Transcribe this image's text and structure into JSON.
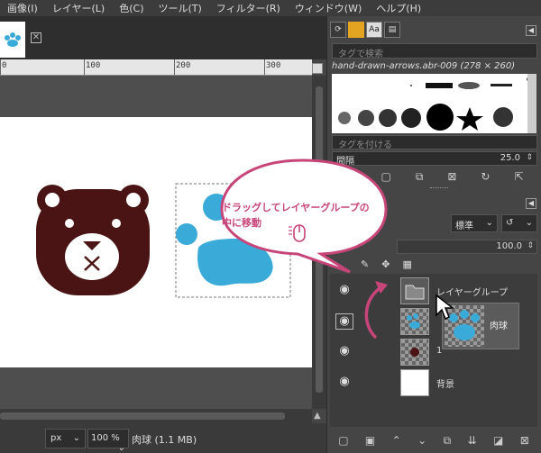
{
  "menu": [
    "画像(I)",
    "レイヤー(L)",
    "色(C)",
    "ツール(T)",
    "フィルター(R)",
    "ウィンドウ(W)",
    "ヘルプ(H)"
  ],
  "ruler": [
    "0",
    "100",
    "200",
    "300"
  ],
  "status": {
    "unit": "px",
    "zoom": "100 %",
    "text": "肉球 (1.1 MB)"
  },
  "brushes": {
    "tab_text": "Aa",
    "tag_search_placeholder": "タグで検索",
    "title": "hand-drawn-arrows.abr-009 (278 × 260)",
    "tag_attach_placeholder": "タグを付ける",
    "spacing_label": "間隔",
    "spacing_value": "25.0"
  },
  "layers": {
    "mode": "標準",
    "opacity": "100.0",
    "items": [
      {
        "name": "レイヤーグループ"
      },
      {
        "name": ""
      },
      {
        "name": "1"
      },
      {
        "name": "背景"
      }
    ]
  },
  "drag": {
    "ghost_name": "肉球"
  },
  "callout": {
    "line1": "ドラッグしてレイヤーグループの",
    "line2": "中に移動"
  },
  "colors": {
    "bear": "#4a1414",
    "paw": "#3aaad8",
    "accent": "#c8457a",
    "orange_tab": "#e3a422"
  }
}
